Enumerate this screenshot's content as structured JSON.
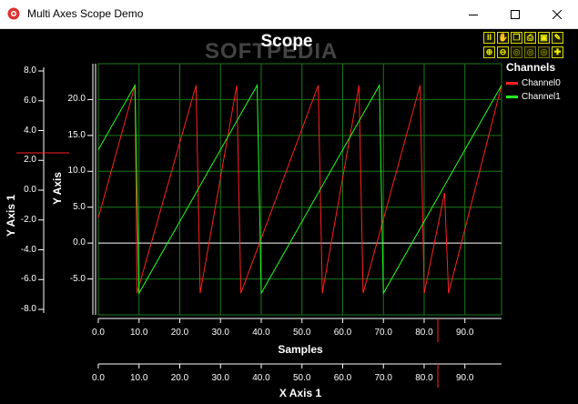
{
  "window": {
    "title": "Multi Axes Scope Demo"
  },
  "toolbar": {
    "row1": [
      "pause-icon",
      "hand-icon",
      "copy-icon",
      "print-icon",
      "save-icon",
      "settings-icon"
    ],
    "row2": [
      "zoom-in-icon",
      "zoom-out-icon",
      "zoom-box-icon",
      "zoom-region-icon",
      "zoom-fit-icon",
      "add-icon"
    ]
  },
  "scope": {
    "title": "Scope",
    "watermark": "SOFTPEDIA",
    "background": "#000000",
    "grid_color": "#1a7a1a"
  },
  "legend": {
    "title": "Channels",
    "items": [
      {
        "name": "Channel0",
        "color": "#ff2020"
      },
      {
        "name": "Channel1",
        "color": "#20ff20"
      }
    ]
  },
  "axes": {
    "y_axis_1": {
      "label": "Y Axis 1",
      "ticks": [
        "8.0",
        "6.0",
        "4.0",
        "2.0",
        "0.0",
        "-2.0",
        "-4.0",
        "-6.0",
        "-8.0"
      ]
    },
    "y_axis": {
      "label": "Y Axis",
      "ticks": [
        "20.0",
        "15.0",
        "10.0",
        "5.0",
        "0.0",
        "-5.0"
      ]
    },
    "samples": {
      "label": "Samples",
      "ticks": [
        "0.0",
        "10.0",
        "20.0",
        "30.0",
        "40.0",
        "50.0",
        "60.0",
        "70.0",
        "80.0",
        "90.0"
      ]
    },
    "x_axis_1": {
      "label": "X Axis 1",
      "ticks": [
        "0.0",
        "10.0",
        "20.0",
        "30.0",
        "40.0",
        "50.0",
        "60.0",
        "70.0",
        "80.0",
        "90.0"
      ]
    }
  },
  "chart_data": {
    "type": "line",
    "xlabel": "Samples",
    "ylabel": "Y Axis",
    "xlim": [
      0,
      99
    ],
    "ylim": [
      -10,
      25
    ],
    "series": [
      {
        "name": "Channel0",
        "color": "#ff2020",
        "points": [
          [
            0,
            3.5
          ],
          [
            9,
            22
          ],
          [
            9.5,
            -7
          ],
          [
            24,
            22
          ],
          [
            25,
            -7
          ],
          [
            34,
            22
          ],
          [
            35,
            -7
          ],
          [
            54,
            22
          ],
          [
            55,
            -7
          ],
          [
            64,
            22
          ],
          [
            65,
            -7
          ],
          [
            79,
            22
          ],
          [
            80,
            -7
          ],
          [
            85,
            7
          ],
          [
            86,
            -7
          ],
          [
            99,
            22
          ]
        ]
      },
      {
        "name": "Channel1",
        "color": "#20ff20",
        "points": [
          [
            0,
            13
          ],
          [
            9,
            22
          ],
          [
            10,
            -7
          ],
          [
            39,
            22
          ],
          [
            40,
            -7
          ],
          [
            69,
            22
          ],
          [
            70,
            -7
          ],
          [
            99,
            22
          ]
        ]
      }
    ]
  }
}
